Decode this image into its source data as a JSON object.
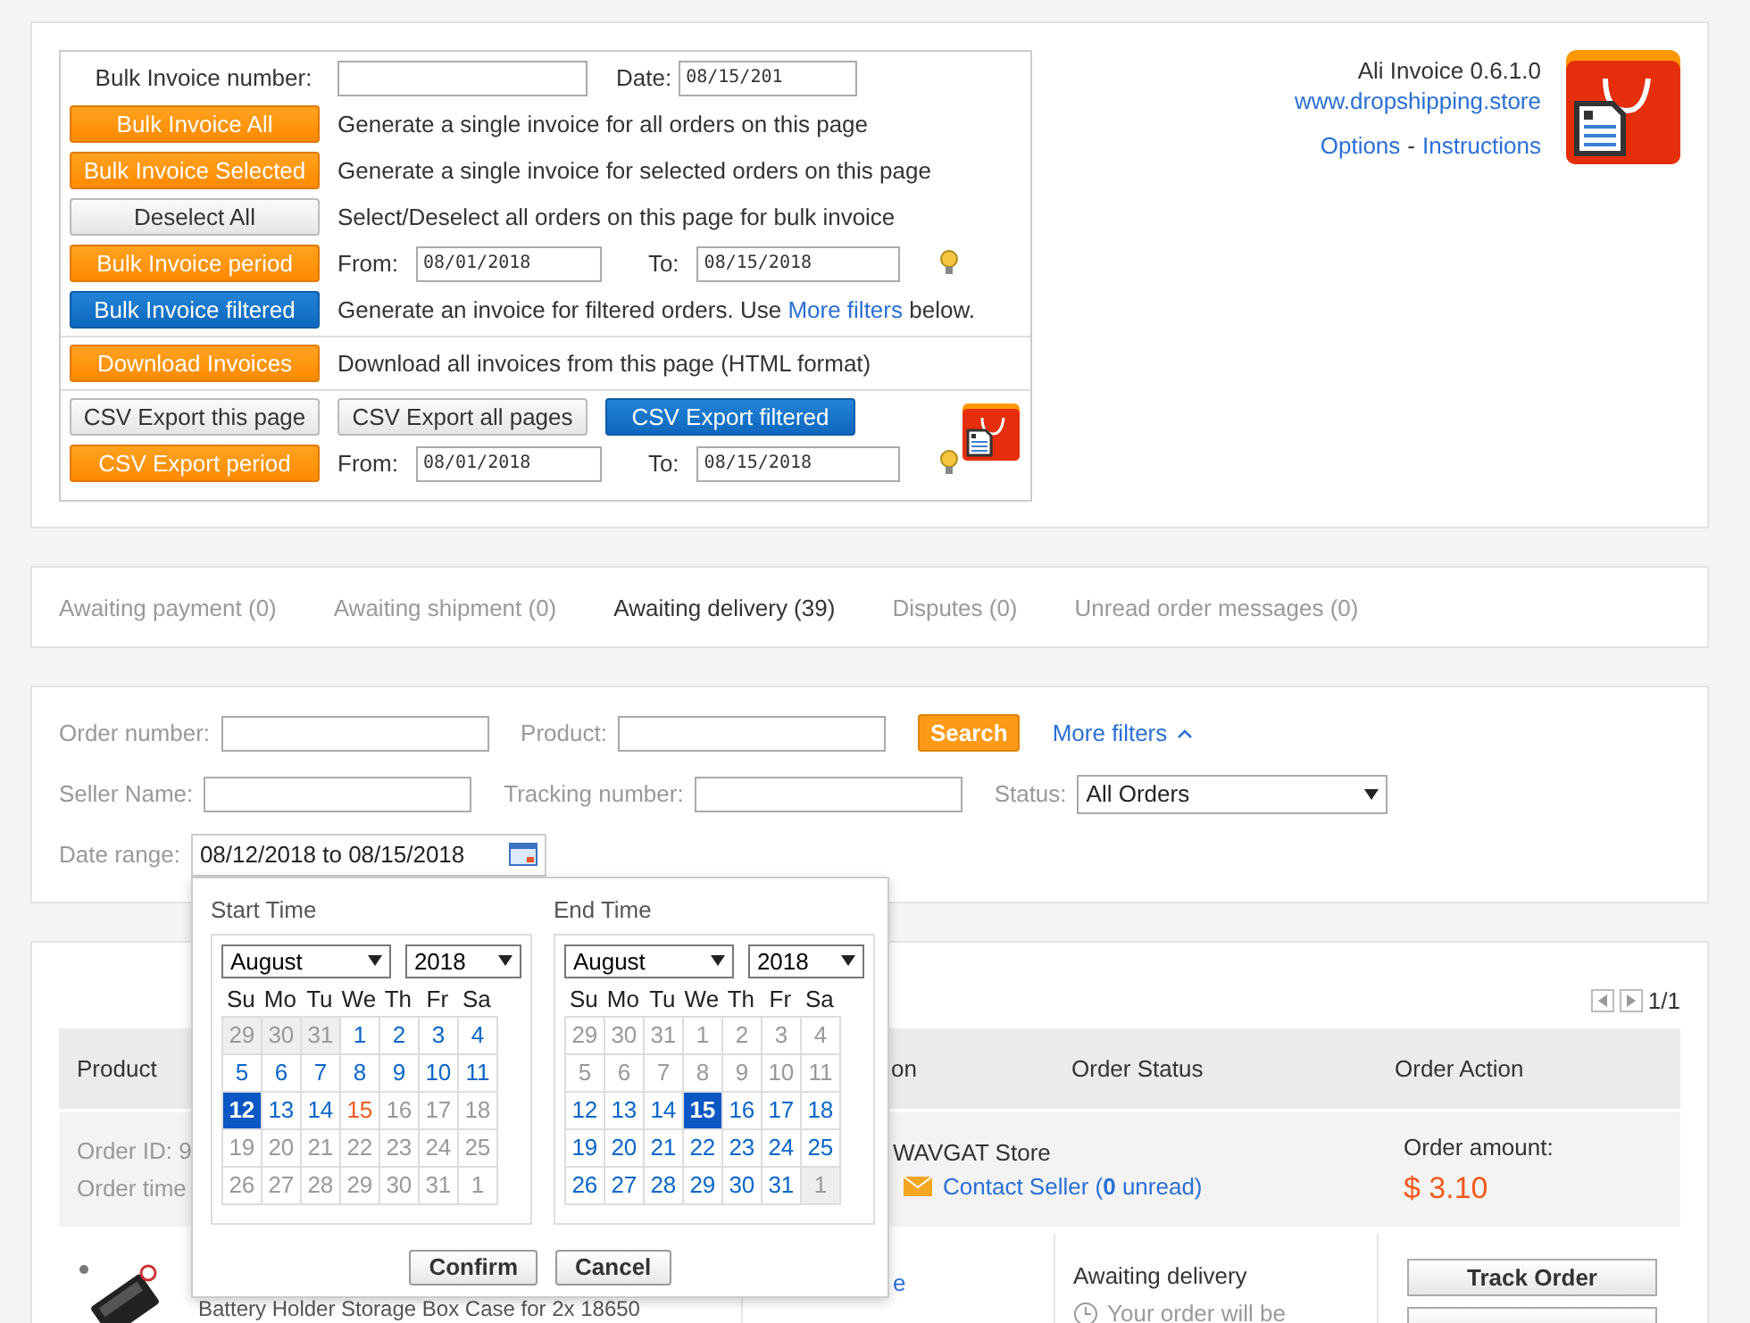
{
  "bulk_panel": {
    "invoice_number": {
      "label": "Bulk Invoice number:"
    },
    "date": {
      "label": "Date:",
      "value": "08/15/201"
    },
    "sections": [
      [
        {
          "kind": "text",
          "button": {
            "label": "Bulk Invoice All",
            "kind": "orange"
          },
          "text": "Generate a single invoice for all orders on this page"
        },
        {
          "kind": "text",
          "button": {
            "label": "Bulk Invoice Selected",
            "kind": "orange"
          },
          "text": "Generate a single invoice for selected orders on this page"
        },
        {
          "kind": "text",
          "button": {
            "label": "Deselect All",
            "kind": "grey"
          },
          "text": "Select/Deselect all orders on this page for bulk invoice"
        },
        {
          "kind": "range",
          "button": {
            "label": "Bulk Invoice period",
            "kind": "orange"
          },
          "from_label": "From:",
          "from": "08/01/2018",
          "to_label": "To:",
          "to": "08/15/2018"
        },
        {
          "kind": "link_text",
          "button": {
            "label": "Bulk Invoice filtered",
            "kind": "blue"
          },
          "text_before": "Generate an invoice for filtered orders. Use",
          "link": "More filters",
          "text_after": "below."
        }
      ],
      [
        {
          "kind": "text",
          "button": {
            "label": "Download Invoices",
            "kind": "orange"
          },
          "text": "Download all invoices from this page (HTML format)"
        }
      ],
      [
        {
          "kind": "buttons",
          "buttons": [
            {
              "label": "CSV Export this page",
              "kind": "grey"
            },
            {
              "label": "CSV Export all pages",
              "kind": "grey"
            },
            {
              "label": "CSV Export filtered",
              "kind": "blue"
            }
          ]
        },
        {
          "kind": "range",
          "button": {
            "label": "CSV Export period",
            "kind": "orange"
          },
          "from_label": "From:",
          "from": "08/01/2018",
          "to_label": "To:",
          "to": "08/15/2018"
        }
      ]
    ]
  },
  "app_header": {
    "title": "Ali Invoice 0.6.1.0",
    "site_link": "www.dropshipping.store",
    "links": [
      "Options",
      "Instructions"
    ],
    "separator": "-"
  },
  "tabs": [
    {
      "label": "Awaiting payment (0)",
      "selected": false
    },
    {
      "label": "Awaiting shipment (0)",
      "selected": false
    },
    {
      "label": "Awaiting delivery (39)",
      "selected": true
    },
    {
      "label": "Disputes (0)",
      "selected": false
    },
    {
      "label": "Unread order messages (0)",
      "selected": false
    }
  ],
  "filters": {
    "order_number": {
      "label": "Order number:"
    },
    "product": {
      "label": "Product:"
    },
    "search_button": "Search",
    "more_filters": "More filters",
    "seller_name": {
      "label": "Seller Name:"
    },
    "tracking_number": {
      "label": "Tracking number:"
    },
    "status": {
      "label": "Status:",
      "value": "All Orders"
    },
    "date_range": {
      "label": "Date range:",
      "value": "08/12/2018 to 08/15/2018"
    }
  },
  "date_picker": {
    "calendars": [
      {
        "title": "Start Time",
        "month": "August",
        "year": "2018",
        "weekdays": [
          "Su",
          "Mo",
          "Tu",
          "We",
          "Th",
          "Fr",
          "Sa"
        ],
        "days": [
          {
            "day": "29",
            "kind": "outside",
            "selected": false
          },
          {
            "day": "30",
            "kind": "outside",
            "selected": false
          },
          {
            "day": "31",
            "kind": "outside",
            "selected": false
          },
          {
            "day": "1",
            "kind": "available",
            "selected": false
          },
          {
            "day": "2",
            "kind": "available",
            "selected": false
          },
          {
            "day": "3",
            "kind": "available",
            "selected": false
          },
          {
            "day": "4",
            "kind": "available",
            "selected": false
          },
          {
            "day": "5",
            "kind": "available",
            "selected": false
          },
          {
            "day": "6",
            "kind": "available",
            "selected": false
          },
          {
            "day": "7",
            "kind": "available",
            "selected": false
          },
          {
            "day": "8",
            "kind": "available",
            "selected": false
          },
          {
            "day": "9",
            "kind": "available",
            "selected": false
          },
          {
            "day": "10",
            "kind": "available",
            "selected": false
          },
          {
            "day": "11",
            "kind": "available",
            "selected": false
          },
          {
            "day": "12",
            "kind": "available",
            "selected": true
          },
          {
            "day": "13",
            "kind": "available",
            "selected": false
          },
          {
            "day": "14",
            "kind": "available",
            "selected": false
          },
          {
            "day": "15",
            "kind": "today",
            "selected": false
          },
          {
            "day": "16",
            "kind": "muted",
            "selected": false
          },
          {
            "day": "17",
            "kind": "muted",
            "selected": false
          },
          {
            "day": "18",
            "kind": "muted",
            "selected": false
          },
          {
            "day": "19",
            "kind": "muted",
            "selected": false
          },
          {
            "day": "20",
            "kind": "muted",
            "selected": false
          },
          {
            "day": "21",
            "kind": "muted",
            "selected": false
          },
          {
            "day": "22",
            "kind": "muted",
            "selected": false
          },
          {
            "day": "23",
            "kind": "muted",
            "selected": false
          },
          {
            "day": "24",
            "kind": "muted",
            "selected": false
          },
          {
            "day": "25",
            "kind": "muted",
            "selected": false
          },
          {
            "day": "26",
            "kind": "muted",
            "selected": false
          },
          {
            "day": "27",
            "kind": "muted",
            "selected": false
          },
          {
            "day": "28",
            "kind": "muted",
            "selected": false
          },
          {
            "day": "29",
            "kind": "muted",
            "selected": false
          },
          {
            "day": "30",
            "kind": "muted",
            "selected": false
          },
          {
            "day": "31",
            "kind": "muted",
            "selected": false
          },
          {
            "day": "1",
            "kind": "muted",
            "selected": false
          }
        ]
      },
      {
        "title": "End Time",
        "month": "August",
        "year": "2018",
        "weekdays": [
          "Su",
          "Mo",
          "Tu",
          "We",
          "Th",
          "Fr",
          "Sa"
        ],
        "days": [
          {
            "day": "29",
            "kind": "muted",
            "selected": false
          },
          {
            "day": "30",
            "kind": "muted",
            "selected": false
          },
          {
            "day": "31",
            "kind": "muted",
            "selected": false
          },
          {
            "day": "1",
            "kind": "muted",
            "selected": false
          },
          {
            "day": "2",
            "kind": "muted",
            "selected": false
          },
          {
            "day": "3",
            "kind": "muted",
            "selected": false
          },
          {
            "day": "4",
            "kind": "muted",
            "selected": false
          },
          {
            "day": "5",
            "kind": "muted",
            "selected": false
          },
          {
            "day": "6",
            "kind": "muted",
            "selected": false
          },
          {
            "day": "7",
            "kind": "muted",
            "selected": false
          },
          {
            "day": "8",
            "kind": "muted",
            "selected": false
          },
          {
            "day": "9",
            "kind": "muted",
            "selected": false
          },
          {
            "day": "10",
            "kind": "muted",
            "selected": false
          },
          {
            "day": "11",
            "kind": "muted",
            "selected": false
          },
          {
            "day": "12",
            "kind": "available",
            "selected": false
          },
          {
            "day": "13",
            "kind": "available",
            "selected": false
          },
          {
            "day": "14",
            "kind": "available",
            "selected": false
          },
          {
            "day": "15",
            "kind": "available",
            "selected": true
          },
          {
            "day": "16",
            "kind": "available",
            "selected": false
          },
          {
            "day": "17",
            "kind": "available",
            "selected": false
          },
          {
            "day": "18",
            "kind": "available",
            "selected": false
          },
          {
            "day": "19",
            "kind": "available",
            "selected": false
          },
          {
            "day": "20",
            "kind": "available",
            "selected": false
          },
          {
            "day": "21",
            "kind": "available",
            "selected": false
          },
          {
            "day": "22",
            "kind": "available",
            "selected": false
          },
          {
            "day": "23",
            "kind": "available",
            "selected": false
          },
          {
            "day": "24",
            "kind": "available",
            "selected": false
          },
          {
            "day": "25",
            "kind": "available",
            "selected": false
          },
          {
            "day": "26",
            "kind": "available",
            "selected": false
          },
          {
            "day": "27",
            "kind": "available",
            "selected": false
          },
          {
            "day": "28",
            "kind": "available",
            "selected": false
          },
          {
            "day": "29",
            "kind": "available",
            "selected": false
          },
          {
            "day": "30",
            "kind": "available",
            "selected": false
          },
          {
            "day": "31",
            "kind": "available",
            "selected": false
          },
          {
            "day": "1",
            "kind": "outside",
            "selected": false
          }
        ]
      }
    ],
    "buttons": [
      "Confirm",
      "Cancel"
    ]
  },
  "orders": {
    "pager": "1/1",
    "columns": [
      "Product",
      "on",
      "Order Status",
      "Order Action"
    ],
    "order": {
      "order_id": "Order ID: 9",
      "order_time": "Order time",
      "store": "WAVGAT Store",
      "contact": "Contact Seller (**0** unread)",
      "amount_label": "Order amount:",
      "amount": "$ 3.10"
    },
    "item": {
      "title": "Battery Holder Storage Box Case for 2x 18650",
      "link": "e",
      "status": "Awaiting delivery",
      "note": "Your order will be",
      "button": "Track Order"
    }
  }
}
